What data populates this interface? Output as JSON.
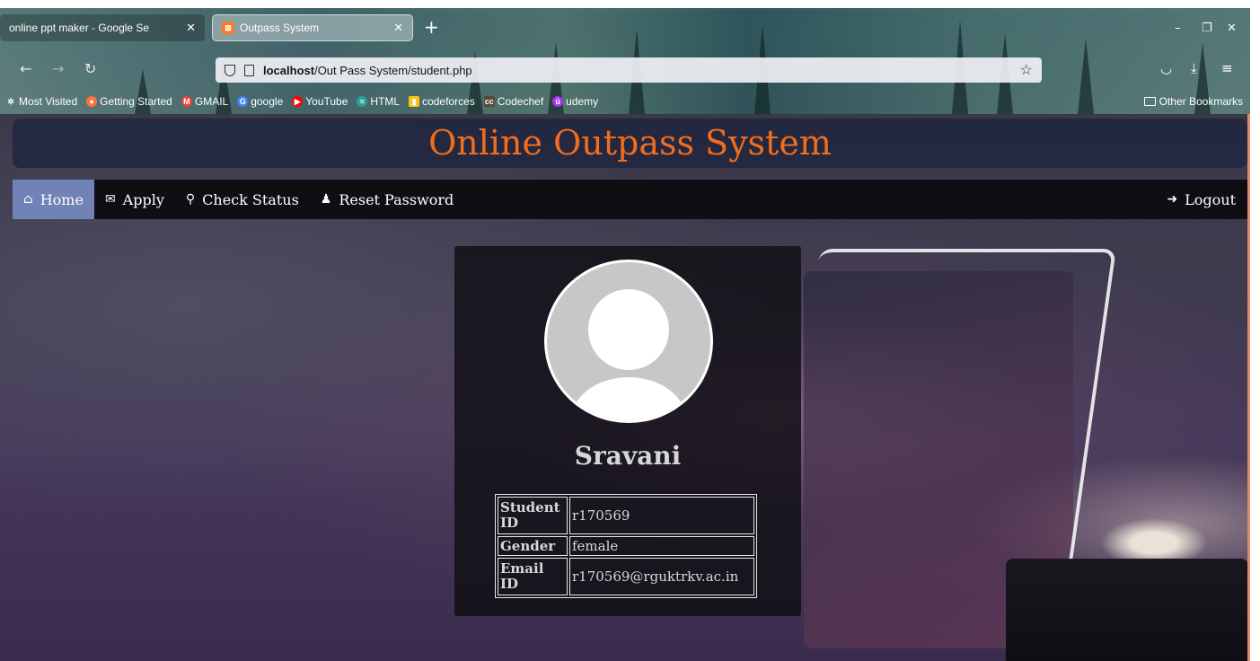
{
  "browser": {
    "tabs": [
      {
        "title": "online ppt maker - Google Se",
        "active": false
      },
      {
        "title": "Outpass System",
        "active": true
      }
    ],
    "url_host": "localhost",
    "url_path": "/Out Pass System/student.php",
    "bookmarks": [
      {
        "label": "Most Visited",
        "icon": "gear-icon",
        "color": "#ffffff"
      },
      {
        "label": "Getting Started",
        "icon": "firefox-icon",
        "color": "#ff7139"
      },
      {
        "label": "GMAIL",
        "icon": "gmail-icon",
        "color": "#ea4335"
      },
      {
        "label": "google",
        "icon": "google-icon",
        "color": "#4285f4"
      },
      {
        "label": "YouTube",
        "icon": "youtube-icon",
        "color": "#ff0000"
      },
      {
        "label": "HTML",
        "icon": "html-icon",
        "color": "#2aa198"
      },
      {
        "label": "codeforces",
        "icon": "codeforces-icon",
        "color": "#f5c518"
      },
      {
        "label": "Codechef",
        "icon": "codechef-icon",
        "color": "#5b4638"
      },
      {
        "label": "udemy",
        "icon": "udemy-icon",
        "color": "#a435f0"
      }
    ],
    "other_bookmarks": "Other Bookmarks"
  },
  "site": {
    "title": "Online Outpass System",
    "title_color": "#f26d1d",
    "active_color": "#7182b7",
    "menu": [
      {
        "label": "Home",
        "icon": "home-icon",
        "active": true
      },
      {
        "label": "Apply",
        "icon": "envelope-icon",
        "active": false
      },
      {
        "label": "Check Status",
        "icon": "search-icon",
        "active": false
      },
      {
        "label": "Reset Password",
        "icon": "user-icon",
        "active": false
      }
    ],
    "logout": {
      "label": "Logout",
      "icon": "sign-out-icon"
    }
  },
  "profile": {
    "name": "Sravani",
    "fields": [
      {
        "label": "Student ID",
        "value": "r170569"
      },
      {
        "label": "Gender",
        "value": "female"
      },
      {
        "label": "Email ID",
        "value": "r170569@rguktrkv.ac.in"
      }
    ]
  }
}
